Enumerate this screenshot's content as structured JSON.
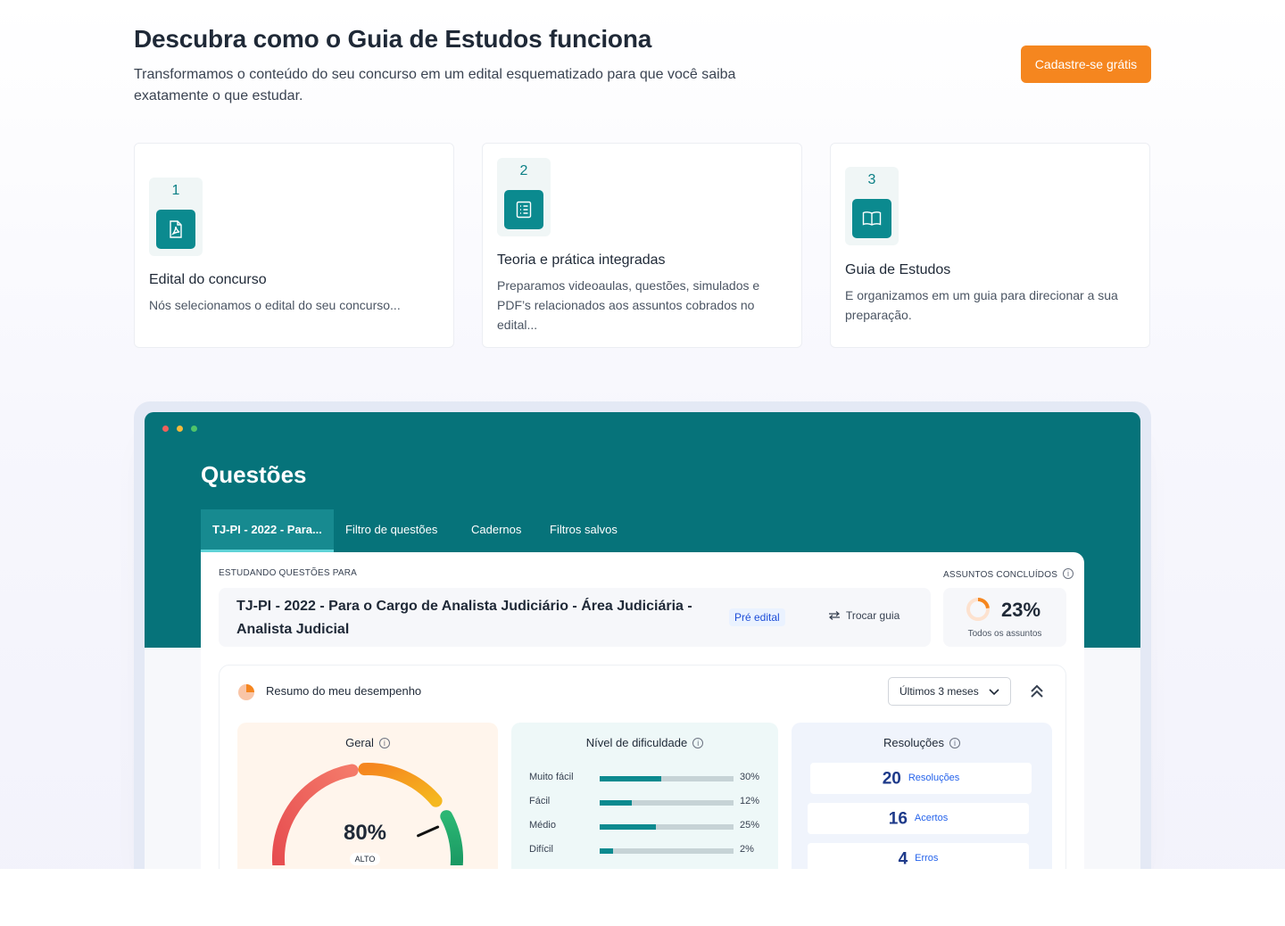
{
  "hero": {
    "title": "Descubra como o Guia de Estudos funciona",
    "subtitle_line1": "Transformamos o conteúdo do seu concurso em um edital esquematizado para que você saiba",
    "subtitle_line2": "exatamente o que estudar.",
    "cta_label": "Cadastre-se grátis"
  },
  "steps": [
    {
      "number": "1",
      "icon": "pdf-icon",
      "title": "Edital do concurso",
      "description": "Nós selecionamos o edital do seu concurso..."
    },
    {
      "number": "2",
      "icon": "checklist-icon",
      "title": "Teoria e prática integradas",
      "description": "Preparamos videoaulas, questões, simulados e PDF’s relacionados aos assuntos cobrados no edital..."
    },
    {
      "number": "3",
      "icon": "book-icon",
      "title": "Guia de Estudos",
      "description": "E organizamos em um guia para direcionar a sua preparação."
    }
  ],
  "mockup": {
    "window_dots": [
      "#f0605c",
      "#f6b93b",
      "#4ec46a"
    ],
    "title": "Questões",
    "tabs": [
      {
        "label": "TJ-PI - 2022 - Para...",
        "active": true
      },
      {
        "label": "Filtro de questões",
        "active": false
      },
      {
        "label": "Cadernos",
        "active": false
      },
      {
        "label": "Filtros salvos",
        "active": false
      }
    ],
    "studying_label": "ESTUDANDO QUESTÕES PARA",
    "guide_name": "TJ-PI - 2022 - Para o Cargo de Analista Judiciário - Área Judiciária - Analista Judicial",
    "guide_badge": "Pré edital",
    "switch_guide": "Trocar guia",
    "completed_label": "ASSUNTOS CONCLUÍDOS",
    "completed_percent": "23%",
    "completed_fraction": 0.23,
    "completed_sub": "Todos os assuntos",
    "performance_title": "Resumo do meu desempenho",
    "period_select": "Últimos 3 meses",
    "general": {
      "title": "Geral",
      "value": "80%",
      "fraction": 0.8,
      "level": "ALTO"
    },
    "difficulty": {
      "title": "Nível de dificuldade",
      "rows": [
        {
          "label": "Muito fácil",
          "percent": "30%",
          "value": 0.46
        },
        {
          "label": "Fácil",
          "percent": "12%",
          "value": 0.24
        },
        {
          "label": "Médio",
          "percent": "25%",
          "value": 0.42
        },
        {
          "label": "Difícil",
          "percent": "2%",
          "value": 0.1
        }
      ]
    },
    "resolutions": {
      "title": "Resoluções",
      "rows": [
        {
          "value": "20",
          "label": "Resoluções"
        },
        {
          "value": "16",
          "label": "Acertos"
        },
        {
          "value": "4",
          "label": "Erros"
        }
      ]
    },
    "colors": {
      "brand_teal": "#06737a",
      "accent_orange": "#f5861f",
      "badge_blue": "#1d4ed8"
    }
  }
}
